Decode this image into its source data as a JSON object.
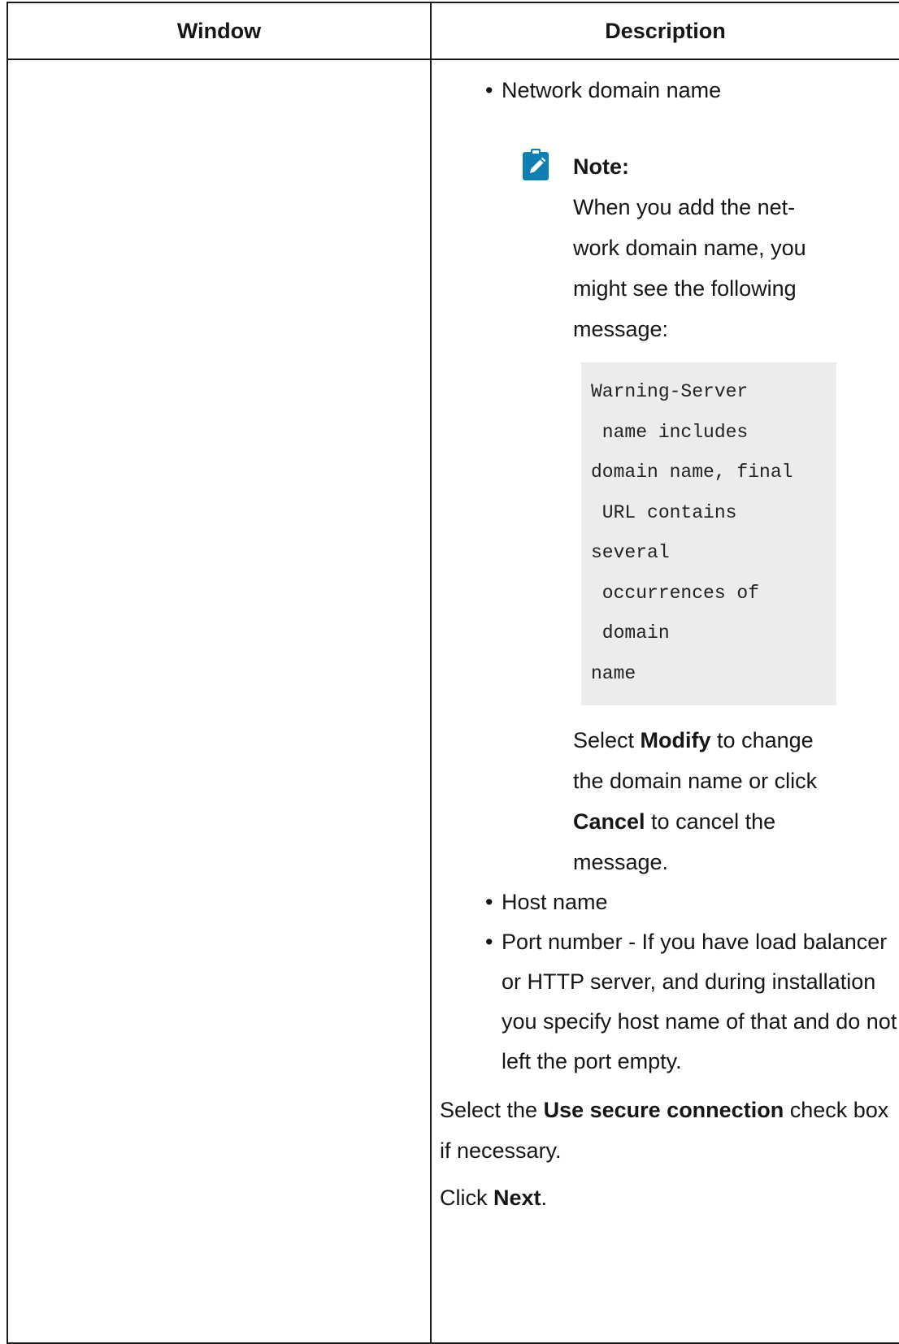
{
  "table": {
    "headers": {
      "window": "Window",
      "description": "Description"
    }
  },
  "description": {
    "bullet_symbol": "•",
    "list_top": [
      "Network domain name"
    ],
    "note": {
      "icon": "note-pencil-icon",
      "icon_color": "#0f7fb2",
      "title": "Note:",
      "body": "When you add the net-work domain name, you might see the following message:",
      "code": "Warning-Server\n name includes\ndomain name, final\n URL contains\nseveral\n occurrences of\n domain\nname",
      "after_pre": "Select ",
      "after_bold1": "Modify",
      "after_mid": " to change the domain name or click ",
      "after_bold2": "Cancel",
      "after_post": " to cancel the message."
    },
    "list_bottom": [
      "Host name",
      "Port number - If you have load balancer or HTTP server, and during installation you specify host name of that and do not left the port empty."
    ],
    "secure": {
      "pre": "Select the ",
      "bold": "Use secure connection",
      "post": " check box if necessary."
    },
    "next": {
      "pre": "Click ",
      "bold": "Next",
      "post": "."
    }
  }
}
